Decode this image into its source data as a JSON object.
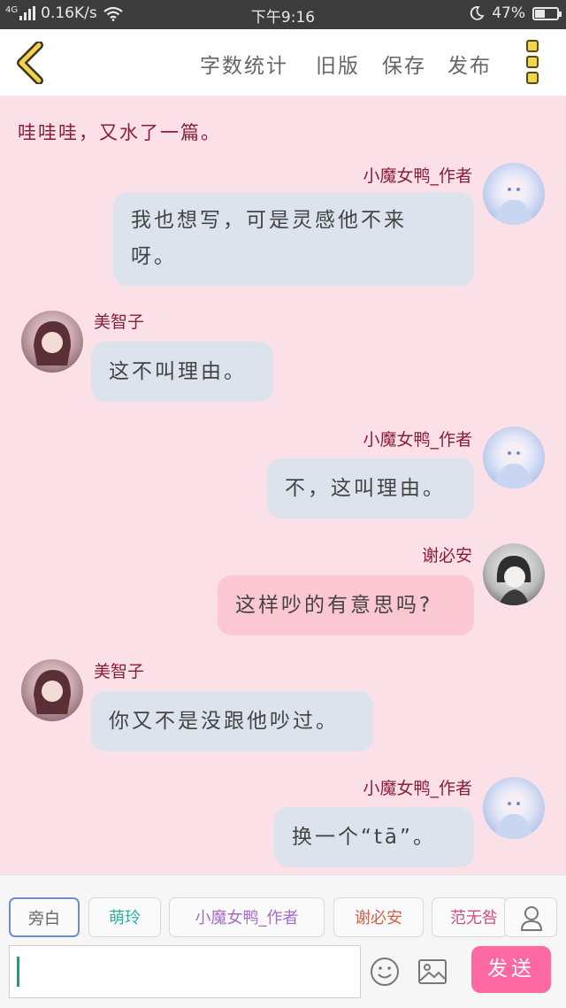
{
  "status_bar": {
    "network": "4G",
    "speed": "0.16K/s",
    "time": "下午9:16",
    "battery": "47%",
    "battery_level": 0.47
  },
  "toolbar": {
    "back_icon": "chevron-left-icon",
    "word_count": "字数统计",
    "old_version": "旧版",
    "save": "保存",
    "publish": "发布",
    "menu_icon": "more-vertical-icon"
  },
  "chat": {
    "narration": "哇哇哇，又水了一篇。",
    "messages": [
      {
        "speaker": "小魔女鸭_作者",
        "text_lines": [
          "我也想写，可是灵感他不来",
          "呀。"
        ],
        "side": "right"
      },
      {
        "speaker": "美智子",
        "text_lines": [
          "这不叫理由。"
        ],
        "side": "left"
      },
      {
        "speaker": "小魔女鸭_作者",
        "text_lines": [
          "不，这叫理由。"
        ],
        "side": "right"
      },
      {
        "speaker": "谢必安",
        "text_lines": [
          "这样吵的有意思吗?"
        ],
        "side": "right"
      },
      {
        "speaker": "美智子",
        "text_lines": [
          "你又不是没跟他吵过。"
        ],
        "side": "left"
      },
      {
        "speaker": "小魔女鸭_作者",
        "text_lines": [
          "换一个“tā”。"
        ],
        "side": "right"
      }
    ]
  },
  "characters": [
    {
      "label": "旁白",
      "color": "#666666"
    },
    {
      "label": "萌玲",
      "color": "#2fae9e"
    },
    {
      "label": "小魔女鸭_作者",
      "color": "#a46cc9"
    },
    {
      "label": "谢必安",
      "color": "#d2624a"
    },
    {
      "label": "范无咎",
      "color": "#d04e8a"
    }
  ],
  "composer": {
    "input_value": "",
    "emoji_icon": "smiley-icon",
    "image_icon": "image-icon",
    "user_icon": "user-icon",
    "send_label": "发送"
  }
}
